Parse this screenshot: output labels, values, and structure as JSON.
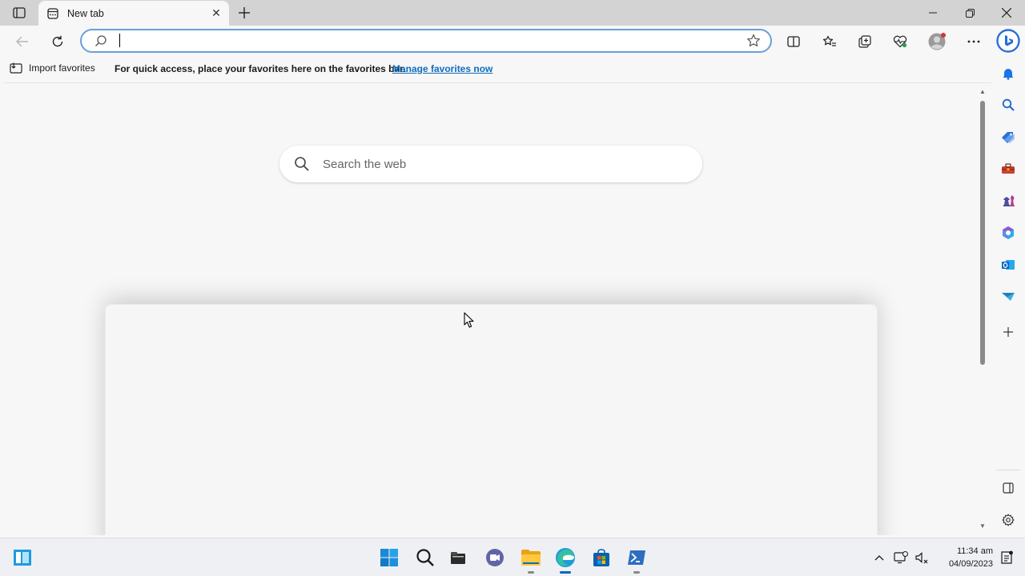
{
  "browser": {
    "tab": {
      "title": "New tab",
      "close_glyph": "✕"
    },
    "address_bar": {
      "value": "",
      "placeholder": ""
    }
  },
  "favorites_bar": {
    "import_label": "Import favorites",
    "message": "For quick access, place your favorites here on the favorites bar.",
    "manage_link": "Manage favorites now"
  },
  "new_tab_page": {
    "search_placeholder": "Search the web"
  },
  "sidebar": {
    "items": [
      "bell-icon",
      "search-icon",
      "shopping-tag-icon",
      "tools-icon",
      "games-icon",
      "microsoft-365-icon",
      "outlook-icon",
      "drop-icon",
      "add-icon"
    ],
    "bottom": [
      "split-screen-icon",
      "settings-icon"
    ]
  },
  "taskbar": {
    "time": "11:34 am",
    "date": "04/09/2023",
    "apps": [
      "windows-start",
      "search",
      "file-manager",
      "teams-chat",
      "file-explorer",
      "edge",
      "store",
      "terminal"
    ]
  },
  "colors": {
    "accent": "#0f6cbd",
    "address_border": "#6a9fd8",
    "titlebar": "#d3d3d3"
  }
}
